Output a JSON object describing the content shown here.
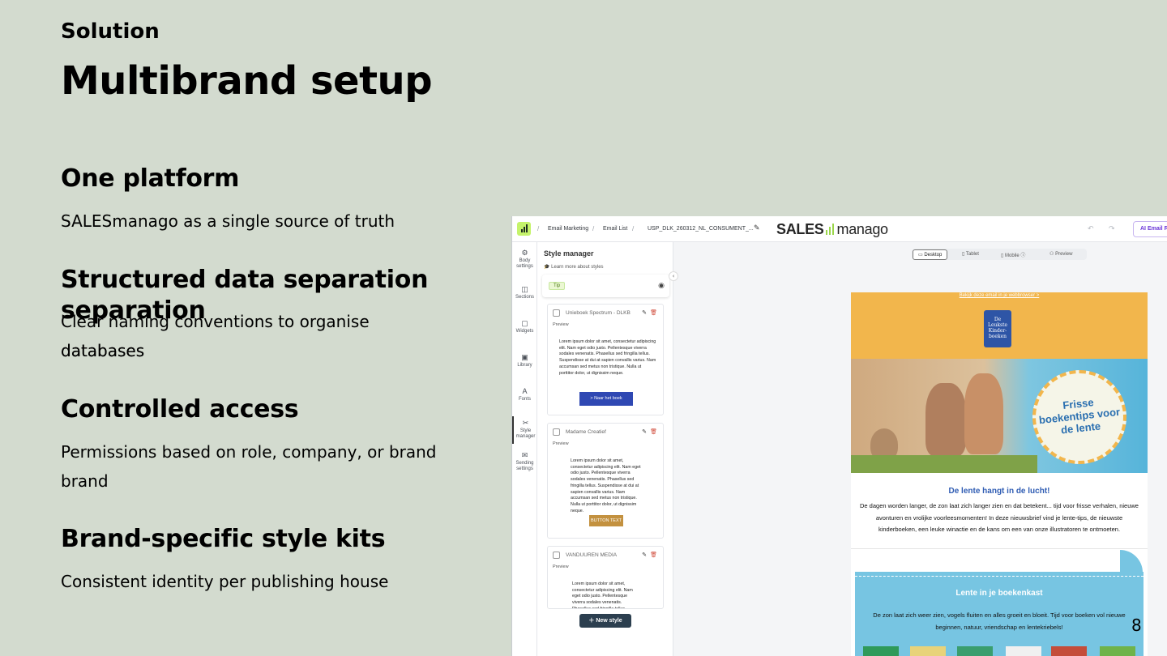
{
  "slide": {
    "kicker": "Solution",
    "title": "Multibrand setup",
    "page_number": "8",
    "sections": [
      {
        "heading": "One platform",
        "body": "SALESmanago as a single source of truth"
      },
      {
        "heading": "Structured data separation",
        "heading_overflow": "separation",
        "body": "Clear naming conventions to organise databases",
        "body_overflow": "databases"
      },
      {
        "heading": "Controlled access",
        "body": "Permissions based on role, company, or brand",
        "body_overflow": "brand"
      },
      {
        "heading": "Brand-specific style kits",
        "body": "Consistent identity per publishing house"
      }
    ]
  },
  "app": {
    "breadcrumbs": [
      "Email Marketing",
      "Email List",
      "USP_DLK_260312_NL_CONSUMENT_..."
    ],
    "brand_left": "SALES",
    "brand_right": "manago",
    "ai_button": "AI Email R",
    "rail": [
      {
        "label": "Body settings",
        "icon": "gear-icon"
      },
      {
        "label": "Sections",
        "icon": "columns-icon"
      },
      {
        "label": "Widgets",
        "icon": "widgets-icon"
      },
      {
        "label": "Library",
        "icon": "library-icon"
      },
      {
        "label": "Fonts",
        "icon": "font-icon"
      },
      {
        "label": "Style manager",
        "icon": "style-icon"
      },
      {
        "label": "Sending settings",
        "icon": "mail-settings-icon"
      }
    ],
    "style_manager": {
      "title": "Style manager",
      "learn_more": "Learn more about styles",
      "tip": "Tip",
      "preview_label": "Preview",
      "styles": [
        {
          "name": "Unieboek Spectrum - DLKB",
          "text": "Lorem ipsum dolor sit amet, consectetur adipiscing elit. Nam eget odio justo. Pellentesque viverra sodales venenatis. Phasellus sed fringilla tellus. Suspendisse at dui at sapien convallis varius. Nam accumsan sed metus non tristique. Nulla ut porttitor dolor, ut dignissim neque.",
          "button": "> Naar het boek",
          "button_color": "#2f48b3"
        },
        {
          "name": "Madame Creatief",
          "text": "Lorem ipsum dolor sit amet, consectetur adipiscing elit. Nam eget odio justo. Pellentesque viverra sodales venenatis. Phasellus sed fringilla tellus. Suspendisse at dui at sapien convallis varius. Nam accumsan sed metus non tristique. Nulla ut porttitor dolor, ut dignissim neque.",
          "button": "BUTTON TEXT",
          "button_color": "#c3913f"
        },
        {
          "name": "VANDUUREN MEDIA",
          "text": "Lorem ipsum dolor sit amet, consectetur adipiscing elit. Nam eget odio justo. Pellentesque viverra sodales venenatis. Phasellus sed fringilla tellus. Suspendisse at dui at",
          "button": "",
          "button_color": ""
        }
      ],
      "new_style": "New style"
    },
    "devices": [
      "Desktop",
      "Tablet",
      "Mobile",
      "Preview"
    ],
    "email": {
      "web_link": "Bekijk deze email in je webbrowser >",
      "logo_text": "De Leukste Kinder- boeken",
      "badge": "Frisse boekentips voor de lente",
      "h1": "De lente hangt in de lucht!",
      "p1": "De dagen worden langer, de zon laat zich langer zien en dat betekent... tijd voor frisse verhalen, nieuwe avonturen en vrolijke voorleesmomenten! In deze nieuwsbrief vind je lente-tips, de nieuwste kinderboeken, een leuke winactie en de kans om een van onze illustratoren te ontmoeten.",
      "h2": "Lente in je boekenkast",
      "p2": "De zon laat zich weer zien, vogels fluiten en alles groeit en bloeit. Tijd voor boeken vol nieuwe beginnen, natuur, vriendschap en lentekriebels!",
      "colors": {
        "header": "#f2b64c",
        "title": "#2f5cb3",
        "box": "#77c5e2"
      }
    }
  }
}
